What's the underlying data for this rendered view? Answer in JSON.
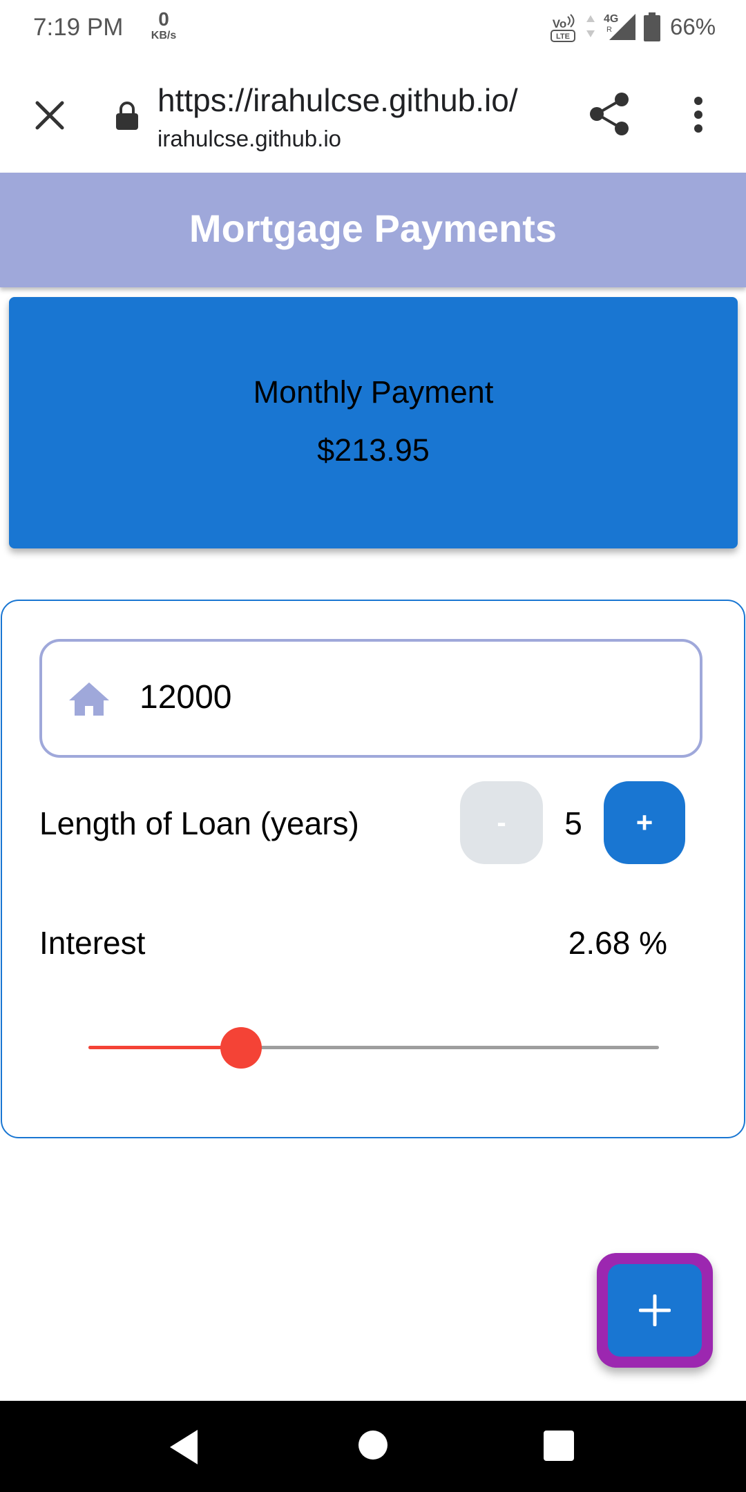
{
  "status_bar": {
    "time": "7:19 PM",
    "speed_value": "0",
    "speed_unit": "KB/s",
    "network": "4G",
    "battery": "66%"
  },
  "browser": {
    "url": "https://irahulcse.github.io/",
    "domain": "irahulcse.github.io",
    "close_icon": "close-icon",
    "lock_icon": "lock-icon",
    "share_icon": "share-icon",
    "menu_icon": "more-vert-icon"
  },
  "app": {
    "title": "Mortgage Payments"
  },
  "payment": {
    "label": "Monthly Payment",
    "value": "$213.95"
  },
  "form": {
    "principal_value": "12000",
    "loan_label": "Length of Loan (years)",
    "minus_label": "-",
    "plus_label": "+",
    "years": "5",
    "interest_label": "Interest",
    "interest_value": "2.68 %",
    "interest_slider_fraction": 0.268
  },
  "fab": {
    "label": "+"
  },
  "colors": {
    "appbar": "#9fa8da",
    "primary": "#1976d2",
    "slider": "#f44336",
    "fab_outline": "#9c27b0"
  }
}
